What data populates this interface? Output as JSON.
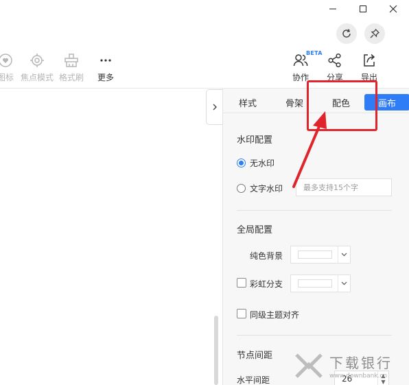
{
  "toolbar": {
    "items": [
      {
        "label": "图标",
        "icon": "heart-circle-icon",
        "state": "disabled"
      },
      {
        "label": "焦点模式",
        "icon": "focus-target-icon",
        "state": "disabled"
      },
      {
        "label": "格式刷",
        "icon": "format-brush-icon",
        "state": "disabled"
      },
      {
        "label": "更多",
        "icon": "more-dots-icon",
        "state": "enabled"
      }
    ],
    "right_items": [
      {
        "label": "协作",
        "icon": "users-icon",
        "badge": "BETA"
      },
      {
        "label": "分享",
        "icon": "share-icon"
      },
      {
        "label": "导出",
        "icon": "export-icon"
      }
    ]
  },
  "panel": {
    "tabs": [
      {
        "label": "样式",
        "active": false
      },
      {
        "label": "骨架",
        "active": false
      },
      {
        "label": "配色",
        "active": false
      },
      {
        "label": "画布",
        "active": true
      }
    ],
    "watermark": {
      "title": "水印配置",
      "option_none": "无水印",
      "option_text": "文字水印",
      "text_placeholder": "最多支持15个字",
      "selected": "无水印"
    },
    "global": {
      "title": "全局配置",
      "solid_bg_label": "纯色背景",
      "rainbow_label": "彩虹分支",
      "align_label": "同级主题对齐"
    },
    "spacing": {
      "title": "节点间距",
      "horizontal_label": "水平间距",
      "horizontal_value": "26"
    }
  },
  "site_watermark": {
    "name": "下载银行",
    "url": "www.downbank.cn"
  },
  "colors": {
    "accent": "#2f7df6",
    "annotation": "#e0242b"
  }
}
